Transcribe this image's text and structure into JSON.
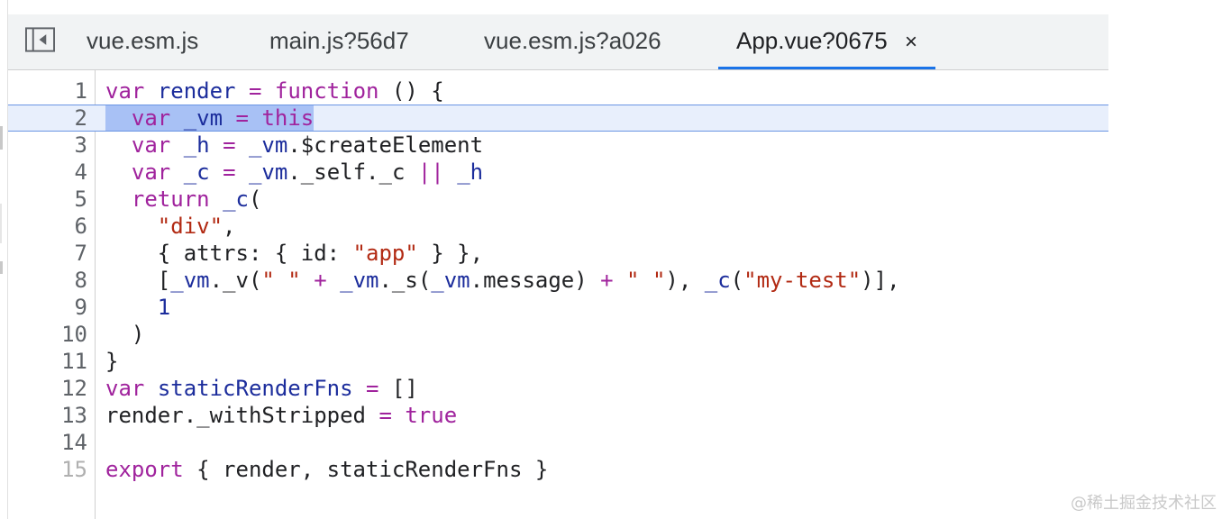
{
  "tabs": [
    {
      "label": "vue.esm.js",
      "active": false
    },
    {
      "label": "main.js?56d7",
      "active": false
    },
    {
      "label": "vue.esm.js?a026",
      "active": false
    },
    {
      "label": "App.vue?0675",
      "active": true,
      "close_icon": "×"
    }
  ],
  "editor": {
    "current_line": 2,
    "lines": [
      {
        "num": "1"
      },
      {
        "num": "2"
      },
      {
        "num": "3"
      },
      {
        "num": "4"
      },
      {
        "num": "5"
      },
      {
        "num": "6"
      },
      {
        "num": "7"
      },
      {
        "num": "8"
      },
      {
        "num": "9"
      },
      {
        "num": "10"
      },
      {
        "num": "11"
      },
      {
        "num": "12"
      },
      {
        "num": "13"
      },
      {
        "num": "14"
      },
      {
        "num": "15"
      }
    ],
    "tokens": {
      "l1": [
        "var",
        "render",
        "=",
        "function",
        "() {"
      ],
      "l2": [
        "var",
        "_vm",
        "=",
        "this"
      ],
      "l3": [
        "var",
        "_h",
        "=",
        "_vm",
        ".$createElement"
      ],
      "l4": [
        "var",
        "_c",
        "=",
        "_vm",
        "._self.",
        "_c",
        "||",
        "_h"
      ],
      "l5": [
        "return",
        "_c",
        "("
      ],
      "l6": [
        "\"div\"",
        ","
      ],
      "l7": [
        "{ attrs: { id: ",
        "\"app\"",
        " } },"
      ],
      "l8": [
        "[",
        "_vm",
        "._v(",
        "\" \"",
        "+",
        "_vm",
        "._s(",
        "_vm",
        ".message)",
        "+",
        "\" \"",
        "), ",
        "_c",
        "(",
        "\"my-test\"",
        ")],"
      ],
      "l9": [
        "1"
      ],
      "l10": [
        ")"
      ],
      "l11": [
        "}"
      ],
      "l12": [
        "var",
        "staticRenderFns",
        "=",
        "[]"
      ],
      "l13": [
        "render._withStripped",
        "=",
        "true"
      ],
      "l14": [
        ""
      ],
      "l15": [
        "export",
        "{ render, staticRenderFns }"
      ]
    }
  },
  "watermark": "@稀土掘金技术社区",
  "icons": {
    "nav_toggle": "sidebar-toggle-icon"
  },
  "colors": {
    "keyword": "#a0239d",
    "variable": "#1c2d9c",
    "string": "#b22a13",
    "active_tab": "#1a73e8",
    "current_line_bg": "#e8effc"
  }
}
